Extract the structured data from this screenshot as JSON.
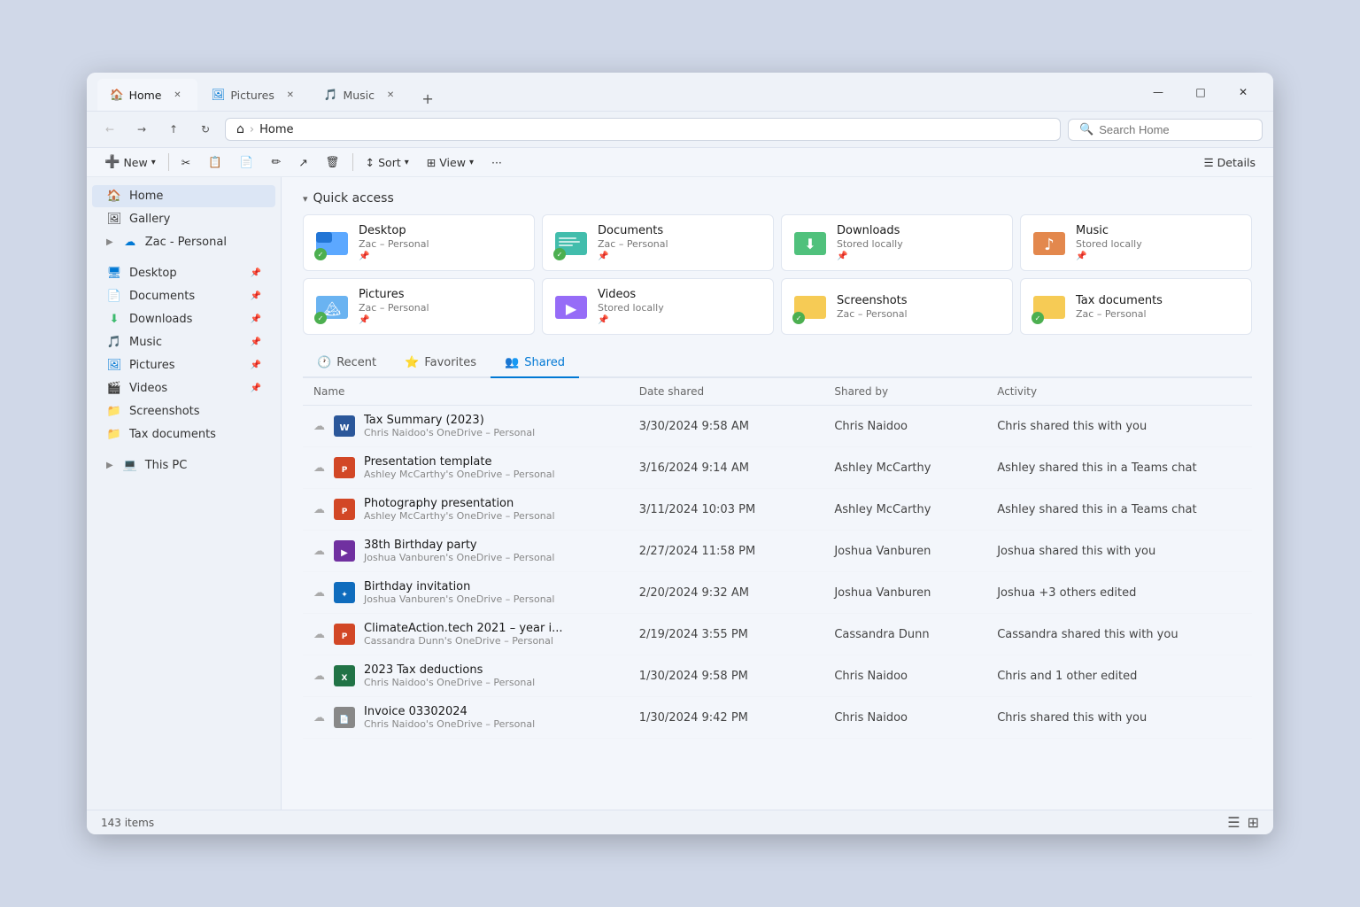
{
  "window": {
    "title": "Home",
    "tabs": [
      {
        "label": "Home",
        "active": true,
        "icon": "home"
      },
      {
        "label": "Pictures",
        "active": false,
        "icon": "pictures"
      },
      {
        "label": "Music",
        "active": false,
        "icon": "music"
      }
    ],
    "add_tab": "+",
    "controls": {
      "minimize": "—",
      "maximize": "□",
      "close": "✕"
    }
  },
  "addressbar": {
    "nav": {
      "back": "←",
      "forward": "→",
      "up": "↑",
      "refresh": "↻"
    },
    "home": "⌂",
    "separator": "›",
    "path": "Home",
    "search_placeholder": "Search Home"
  },
  "toolbar": {
    "new_label": "New",
    "new_arrow": "▾",
    "buttons": [
      "cut",
      "copy",
      "paste",
      "rename",
      "share",
      "delete",
      "sort",
      "view",
      "more"
    ],
    "sort_label": "Sort",
    "sort_arrow": "▾",
    "view_label": "View",
    "view_arrow": "▾",
    "more": "···",
    "details_icon": "☰",
    "details_label": "Details"
  },
  "sidebar": {
    "items": [
      {
        "id": "home",
        "label": "Home",
        "icon": "🏠",
        "active": true
      },
      {
        "id": "gallery",
        "label": "Gallery",
        "icon": "🖼",
        "active": false
      },
      {
        "id": "zac-personal",
        "label": "Zac - Personal",
        "icon": "☁",
        "expand": true
      }
    ],
    "pinned": [
      {
        "id": "desktop",
        "label": "Desktop",
        "icon": "🖥",
        "pin": "📌"
      },
      {
        "id": "documents",
        "label": "Documents",
        "icon": "📄",
        "pin": "📌"
      },
      {
        "id": "downloads",
        "label": "Downloads",
        "icon": "⬇",
        "pin": "📌"
      },
      {
        "id": "music",
        "label": "Music",
        "icon": "🎵",
        "pin": "📌"
      },
      {
        "id": "pictures",
        "label": "Pictures",
        "icon": "🖼",
        "pin": "📌"
      },
      {
        "id": "videos",
        "label": "Videos",
        "icon": "🎬",
        "pin": "📌"
      },
      {
        "id": "screenshots",
        "label": "Screenshots",
        "icon": "📁"
      },
      {
        "id": "tax-documents",
        "label": "Tax documents",
        "icon": "📁"
      }
    ],
    "this_pc": {
      "label": "This PC",
      "icon": "💻",
      "expand": true
    }
  },
  "quick_access": {
    "header": "Quick access",
    "folders": [
      {
        "name": "Desktop",
        "sub": "Zac – Personal",
        "color": "blue",
        "sync": true,
        "pin": "📌"
      },
      {
        "name": "Documents",
        "sub": "Zac – Personal",
        "color": "teal",
        "sync": true,
        "pin": "📌"
      },
      {
        "name": "Downloads",
        "sub": "Stored locally",
        "color": "green",
        "sync": false,
        "pin": "📌"
      },
      {
        "name": "Music",
        "sub": "Stored locally",
        "color": "orange",
        "sync": false,
        "pin": "📌"
      },
      {
        "name": "Pictures",
        "sub": "Zac – Personal",
        "color": "blue",
        "sync": true,
        "pin": "📌"
      },
      {
        "name": "Videos",
        "sub": "Stored locally",
        "color": "purple",
        "sync": false,
        "pin": "📌"
      },
      {
        "name": "Screenshots",
        "sub": "Zac – Personal",
        "color": "yellow",
        "sync": true,
        "pin": null
      },
      {
        "name": "Tax documents",
        "sub": "Zac – Personal",
        "color": "yellow",
        "sync": true,
        "pin": null
      }
    ]
  },
  "content_tabs": [
    {
      "label": "Recent",
      "icon": "🕐",
      "active": false
    },
    {
      "label": "Favorites",
      "icon": "⭐",
      "active": false
    },
    {
      "label": "Shared",
      "icon": "👥",
      "active": true
    }
  ],
  "shared_table": {
    "columns": [
      "Name",
      "Date shared",
      "Shared by",
      "Activity"
    ],
    "rows": [
      {
        "name": "Tax Summary (2023)",
        "sub": "Chris Naidoo's OneDrive – Personal",
        "date": "3/30/2024 9:58 AM",
        "shared_by": "Chris Naidoo",
        "activity": "Chris shared this with you",
        "file_type": "word"
      },
      {
        "name": "Presentation template",
        "sub": "Ashley McCarthy's OneDrive – Personal",
        "date": "3/16/2024 9:14 AM",
        "shared_by": "Ashley McCarthy",
        "activity": "Ashley shared this in a Teams chat",
        "file_type": "ppt"
      },
      {
        "name": "Photography presentation",
        "sub": "Ashley McCarthy's OneDrive – Personal",
        "date": "3/11/2024 10:03 PM",
        "shared_by": "Ashley McCarthy",
        "activity": "Ashley shared this in a Teams chat",
        "file_type": "ppt"
      },
      {
        "name": "38th Birthday party",
        "sub": "Joshua Vanburen's OneDrive – Personal",
        "date": "2/27/2024 11:58 PM",
        "shared_by": "Joshua Vanburen",
        "activity": "Joshua shared this with you",
        "file_type": "video"
      },
      {
        "name": "Birthday invitation",
        "sub": "Joshua Vanburen's OneDrive – Personal",
        "date": "2/20/2024 9:32 AM",
        "shared_by": "Joshua Vanburen",
        "activity": "Joshua +3 others edited",
        "file_type": "design"
      },
      {
        "name": "ClimateAction.tech 2021 – year i...",
        "sub": "Cassandra Dunn's OneDrive – Personal",
        "date": "2/19/2024 3:55 PM",
        "shared_by": "Cassandra Dunn",
        "activity": "Cassandra shared this with you",
        "file_type": "ppt"
      },
      {
        "name": "2023 Tax deductions",
        "sub": "Chris Naidoo's OneDrive – Personal",
        "date": "1/30/2024 9:58 PM",
        "shared_by": "Chris Naidoo",
        "activity": "Chris and 1 other edited",
        "file_type": "excel"
      },
      {
        "name": "Invoice 03302024",
        "sub": "Chris Naidoo's OneDrive – Personal",
        "date": "1/30/2024 9:42 PM",
        "shared_by": "Chris Naidoo",
        "activity": "Chris shared this with you",
        "file_type": "text"
      }
    ]
  },
  "statusbar": {
    "count": "143 items",
    "view_list": "☰",
    "view_grid": "⊞"
  }
}
